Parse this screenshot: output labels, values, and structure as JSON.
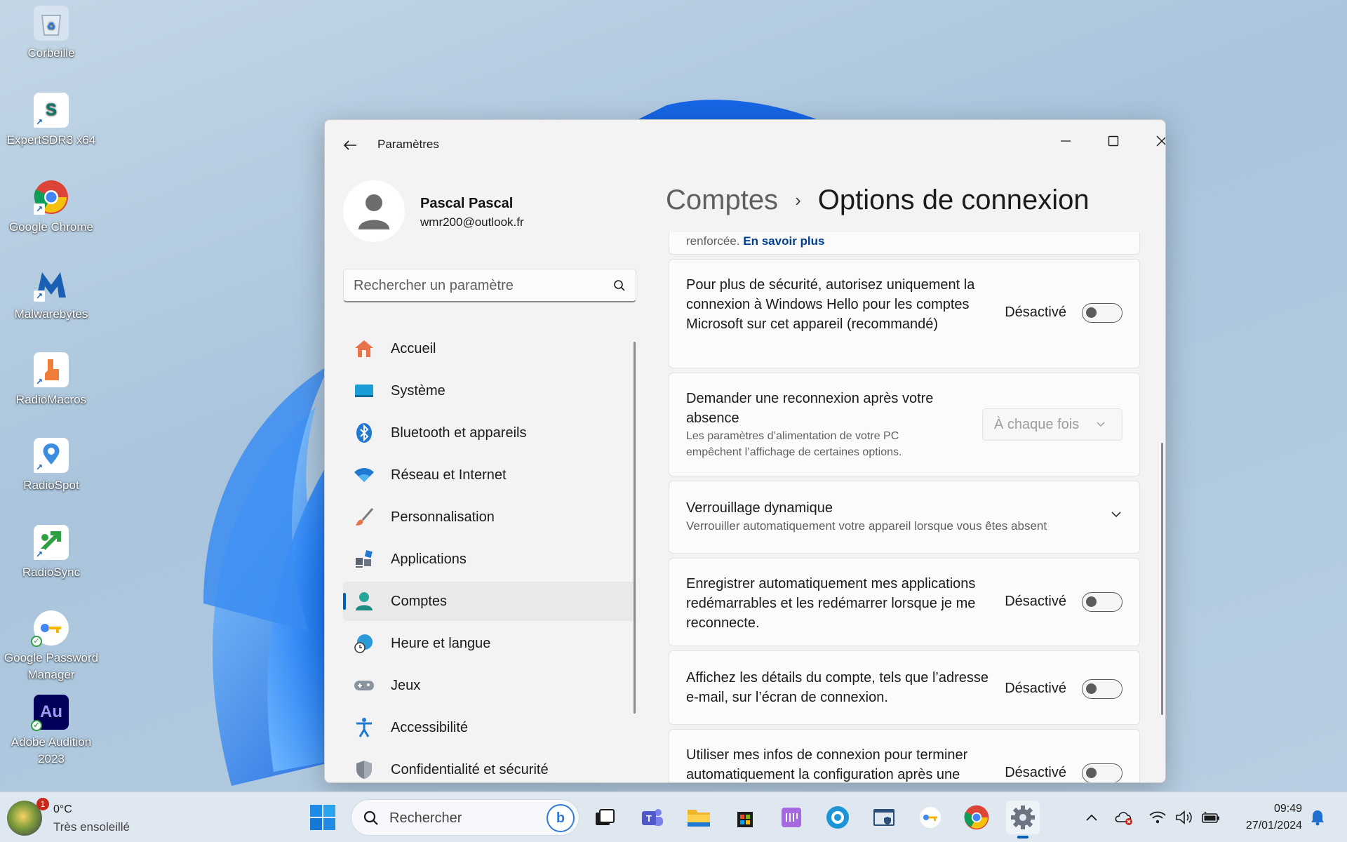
{
  "desktop": {
    "icons": [
      {
        "label": "Corbeille",
        "icon": "recycle-bin-icon",
        "color": "#dfe8f0"
      },
      {
        "label": "ExpertSDR3 x64",
        "icon": "expertsdr-icon",
        "color": "#ffffff"
      },
      {
        "label": "Google Chrome",
        "icon": "chrome-icon",
        "color": "#ffffff"
      },
      {
        "label": "Malwarebytes",
        "icon": "malwarebytes-icon",
        "color": "#1a5fb4"
      },
      {
        "label": "RadioMacros",
        "icon": "radiomacros-icon",
        "color": "#ffffff"
      },
      {
        "label": "RadioSpot",
        "icon": "radiospot-icon",
        "color": "#ffffff"
      },
      {
        "label": "RadioSync",
        "icon": "radiosync-icon",
        "color": "#ffffff"
      },
      {
        "label": "Google Password Manager",
        "icon": "password-manager-icon",
        "color": "#ffffff"
      },
      {
        "label": "Adobe Audition 2023",
        "icon": "adobe-audition-icon",
        "color": "#00005b",
        "glyph": "Au"
      }
    ]
  },
  "window": {
    "title": "Paramètres",
    "profile": {
      "name": "Pascal Pascal",
      "email": "wmr200@outlook.fr"
    },
    "search": {
      "placeholder": "Rechercher un paramètre"
    },
    "nav": [
      {
        "label": "Accueil",
        "icon": "home-icon",
        "active": false
      },
      {
        "label": "Système",
        "icon": "display-icon",
        "active": false
      },
      {
        "label": "Bluetooth et appareils",
        "icon": "bluetooth-icon",
        "active": false
      },
      {
        "label": "Réseau et Internet",
        "icon": "wifi-icon",
        "active": false
      },
      {
        "label": "Personnalisation",
        "icon": "brush-icon",
        "active": false
      },
      {
        "label": "Applications",
        "icon": "apps-icon",
        "active": false
      },
      {
        "label": "Comptes",
        "icon": "person-icon",
        "active": true
      },
      {
        "label": "Heure et langue",
        "icon": "globe-clock-icon",
        "active": false
      },
      {
        "label": "Jeux",
        "icon": "gamepad-icon",
        "active": false
      },
      {
        "label": "Accessibilité",
        "icon": "accessibility-icon",
        "active": false
      },
      {
        "label": "Confidentialité et sécurité",
        "icon": "shield-icon",
        "active": false
      }
    ],
    "breadcrumb": {
      "parent": "Comptes",
      "separator": "›",
      "current": "Options de connexion"
    },
    "content": {
      "partial_card": {
        "text": "renforcée.",
        "link": "En savoir plus"
      },
      "hello_only": {
        "text": "Pour plus de sécurité, autorisez uniquement la connexion à Windows Hello pour les comptes Microsoft sur cet appareil (recommandé)",
        "state": "Désactivé",
        "on": false
      },
      "reconnect": {
        "title": "Demander une reconnexion après votre absence",
        "desc": "Les paramètres d’alimentation de votre PC empêchent l’affichage de certaines options.",
        "dropdown_value": "À chaque fois"
      },
      "dynamic_lock": {
        "title": "Verrouillage dynamique",
        "desc": "Verrouiller automatiquement votre appareil lorsque vous êtes absent"
      },
      "restart_apps": {
        "text": "Enregistrer automatiquement mes applications redémarrables et les redémarrer lorsque je me reconnecte.",
        "state": "Désactivé",
        "on": false
      },
      "account_details": {
        "text": "Affichez les détails du compte, tels que l’adresse e-mail, sur l’écran de connexion.",
        "state": "Désactivé",
        "on": false
      },
      "signin_info": {
        "text": "Utiliser mes infos de connexion pour terminer automatiquement la configuration après une",
        "state": "Désactivé",
        "on": false
      }
    }
  },
  "taskbar": {
    "weather": {
      "temp": "0°C",
      "condition": "Très ensoleillé",
      "badge": "1"
    },
    "search_placeholder": "Rechercher",
    "apps": [
      "task-view-icon",
      "teams-icon",
      "file-explorer-icon",
      "store-icon",
      "notepad-icon",
      "radio-app-icon",
      "security-icon",
      "password-manager-icon",
      "chrome-icon",
      "settings-icon"
    ],
    "clock": {
      "time": "09:49",
      "date": "27/01/2024"
    }
  },
  "colors": {
    "accent": "#005fb8",
    "window_bg": "#f3f3f3",
    "card_bg": "#fbfbfb"
  }
}
